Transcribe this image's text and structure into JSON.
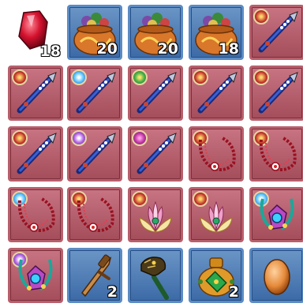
{
  "inventory": {
    "slots": [
      {
        "item": "red-gem",
        "frame": "blue",
        "qty": "18"
      },
      {
        "item": "treasure-bag",
        "frame": "blue",
        "qty": "20"
      },
      {
        "item": "treasure-bag",
        "frame": "blue",
        "qty": "20"
      },
      {
        "item": "treasure-bag",
        "frame": "blue",
        "qty": "18"
      },
      {
        "item": "blue-spear",
        "frame": "red",
        "qty": ""
      },
      {
        "item": "blue-spear",
        "frame": "red",
        "badge": "red",
        "qty": ""
      },
      {
        "item": "blue-spear",
        "frame": "red",
        "badge": "blue",
        "qty": ""
      },
      {
        "item": "blue-spear",
        "frame": "red",
        "badge": "green",
        "qty": ""
      },
      {
        "item": "blue-spear",
        "frame": "red",
        "badge": "red",
        "qty": ""
      },
      {
        "item": "blue-spear",
        "frame": "red",
        "badge": "red",
        "qty": ""
      },
      {
        "item": "blue-spear",
        "frame": "red",
        "badge": "red",
        "qty": ""
      },
      {
        "item": "blue-spear",
        "frame": "red",
        "badge": "purple",
        "qty": ""
      },
      {
        "item": "blue-spear",
        "frame": "red",
        "badge": "violet",
        "qty": ""
      },
      {
        "item": "red-necklace",
        "frame": "red",
        "badge": "red",
        "qty": ""
      },
      {
        "item": "red-necklace",
        "frame": "red",
        "badge": "red",
        "qty": ""
      },
      {
        "item": "red-necklace",
        "frame": "red",
        "badge": "blue",
        "qty": ""
      },
      {
        "item": "red-necklace",
        "frame": "red",
        "badge": "red",
        "qty": ""
      },
      {
        "item": "lotus-flower",
        "frame": "red",
        "badge": "red",
        "qty": ""
      },
      {
        "item": "lotus-flower",
        "frame": "red",
        "badge": "red",
        "qty": ""
      },
      {
        "item": "jeweled-amulet",
        "frame": "red",
        "badge": "blue",
        "qty": ""
      },
      {
        "item": "jeweled-amulet",
        "frame": "red",
        "badge": "purple",
        "qty": ""
      },
      {
        "item": "bronze-sword",
        "frame": "blue",
        "qty": "2"
      },
      {
        "item": "horse-head-staff",
        "frame": "blue",
        "qty": ""
      },
      {
        "item": "green-pouch",
        "frame": "blue",
        "qty": "2"
      },
      {
        "item": "orange-egg",
        "frame": "blue",
        "qty": ""
      }
    ]
  }
}
